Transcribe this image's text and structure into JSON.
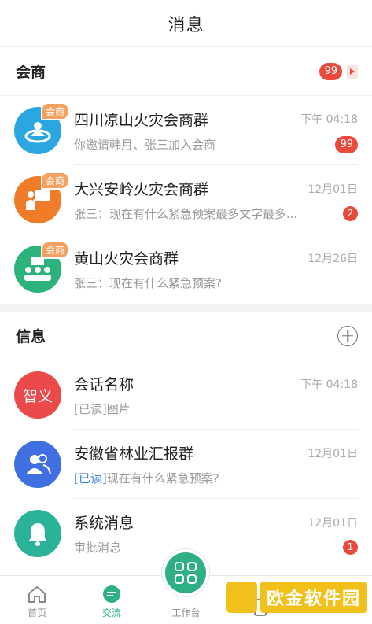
{
  "header": {
    "title": "消息"
  },
  "merchant_section": {
    "label": "会商",
    "badge": "99",
    "items": [
      {
        "name": "四川凉山火灾会商群",
        "time": "下午  04:18",
        "preview": "你邀请韩月、张三加入会商",
        "badge": "99",
        "tag": "会商",
        "avatar_color": "#2aa7e0",
        "icon": "group-target-icon"
      },
      {
        "name": "大兴安岭火灾会商群",
        "time": "12月01日",
        "preview": "张三：现在有什么紧急预案最多文字最多...",
        "badge": "2",
        "tag": "会商",
        "avatar_color": "#f07c2a",
        "icon": "presenter-icon"
      },
      {
        "name": "黄山火灾会商群",
        "time": "12月26日",
        "preview": "张三：现在有什么紧急预案?",
        "badge": "",
        "tag": "会商",
        "avatar_color": "#2bb37b",
        "icon": "meeting-icon"
      }
    ]
  },
  "info_section": {
    "label": "信息",
    "items": [
      {
        "name": "会话名称",
        "time": "下午  04:18",
        "read_tag": "[已读]",
        "preview": "图片",
        "badge": "",
        "avatar_text": "智义",
        "avatar_color": "#ea4a4a"
      },
      {
        "name": "安徽省林业汇报群",
        "time": "12月01日",
        "read_tag": "[已读]",
        "preview": "现在有什么紧急预案?",
        "badge": "",
        "avatar_color": "#3f6fe0",
        "icon": "group-users-icon"
      },
      {
        "name": "系统消息",
        "time": "12月01日",
        "read_tag": "",
        "preview": "审批消息",
        "badge": "1",
        "avatar_color": "#2bb39a",
        "icon": "bell-icon"
      }
    ]
  },
  "tabbar": {
    "tabs": [
      "首页",
      "交流",
      "工作台",
      "",
      ""
    ],
    "accent": "#2eb082"
  },
  "watermark": {
    "text": "欧金软件园"
  }
}
